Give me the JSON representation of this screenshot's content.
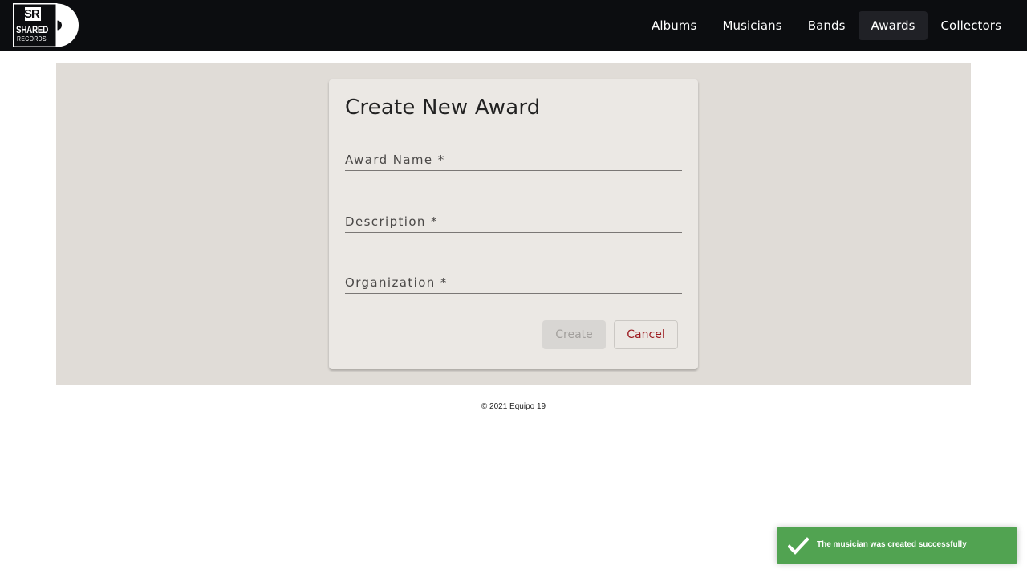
{
  "navbar": {
    "logo": {
      "line1": "SR",
      "line2": "SHARED",
      "line3": "RECORDS"
    },
    "items": [
      {
        "label": "Albums",
        "active": false
      },
      {
        "label": "Musicians",
        "active": false
      },
      {
        "label": "Bands",
        "active": false
      },
      {
        "label": "Awards",
        "active": true
      },
      {
        "label": "Collectors",
        "active": false
      }
    ]
  },
  "form": {
    "title": "Create New Award",
    "fields": [
      {
        "label": "Award Name *",
        "value": ""
      },
      {
        "label": "Description *",
        "value": ""
      },
      {
        "label": "Organization *",
        "value": ""
      }
    ],
    "create_label": "Create",
    "cancel_label": "Cancel"
  },
  "footer": {
    "text": "© 2021 Equipo 19"
  },
  "toast": {
    "message": "The musician was created successfully",
    "icon": "check-icon"
  },
  "colors": {
    "navbar_bg": "#0c0d10",
    "content_bg": "#e0dcd7",
    "card_bg": "#ebe8e4",
    "cancel_text": "#9b1a1f",
    "toast_bg": "#51a351"
  }
}
